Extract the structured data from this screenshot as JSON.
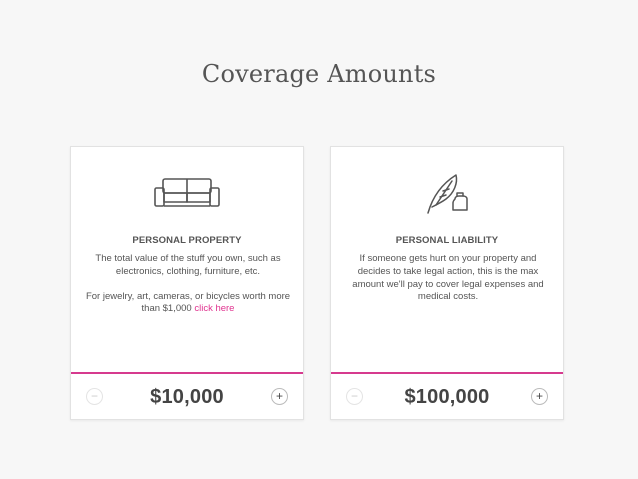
{
  "page": {
    "title": "Coverage Amounts"
  },
  "cards": [
    {
      "icon": "sofa-icon",
      "heading": "PERSONAL PROPERTY",
      "description_1": "The total value of the stuff you own, such as electronics, clothing, furniture, etc.",
      "description_2_prefix": "For jewelry, art, cameras, or bicycles worth more than $1,000",
      "description_2_link": "click here",
      "amount": "$10,000",
      "minus_label": "−",
      "plus_label": "+"
    },
    {
      "icon": "quill-inkwell-icon",
      "heading": "PERSONAL LIABILITY",
      "description_1": "If someone gets hurt on your property and decides to take legal action, this is the max amount we'll pay to cover legal expenses and medical costs.",
      "amount": "$100,000",
      "minus_label": "−",
      "plus_label": "+"
    }
  ],
  "colors": {
    "accent": "#d63a8e",
    "link": "#e0338f",
    "background": "#f7f7f7"
  }
}
